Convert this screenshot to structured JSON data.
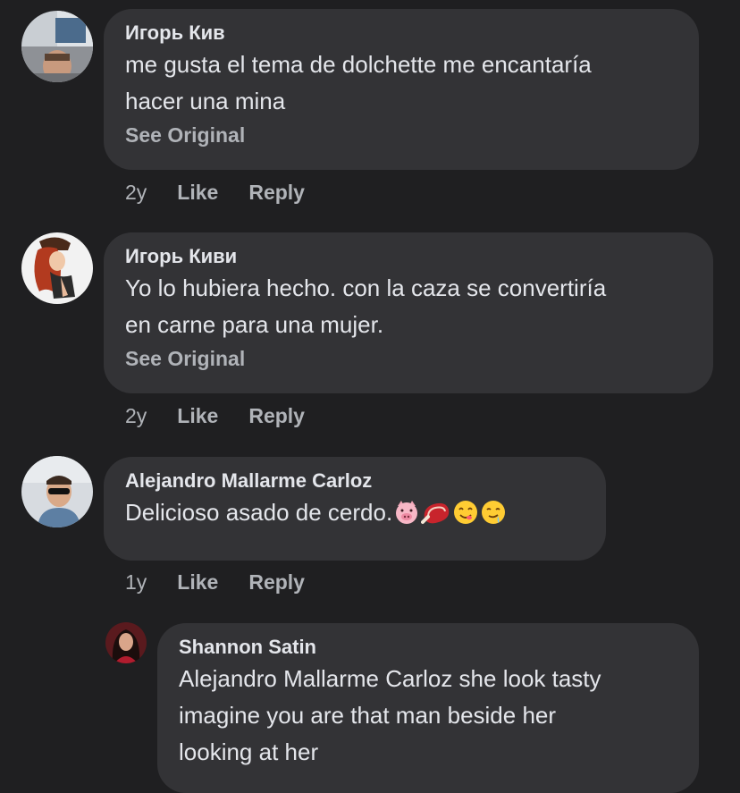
{
  "comments": [
    {
      "author": "Игорь Кив",
      "text": "me gusta el tema de dolchette me encantaría\nhacer una mina",
      "see_original": "See Original",
      "time": "2y",
      "like": "Like",
      "reply": "Reply"
    },
    {
      "author": "Игорь Киви",
      "text": "Yo lo hubiera hecho. con la caza se convertiría\nen carne para una mujer.",
      "see_original": "See Original",
      "time": "2y",
      "like": "Like",
      "reply": "Reply"
    },
    {
      "author": "Alejandro Mallarme Carloz",
      "text": "Delicioso asado de cerdo.",
      "emojis": [
        "pig-face-emoji",
        "meat-emoji",
        "yum-face-emoji",
        "drooling-face-emoji"
      ],
      "time": "1y",
      "like": "Like",
      "reply": "Reply"
    },
    {
      "author": "Shannon Satin",
      "text": "Alejandro Mallarme Carloz she look tasty\nimagine you are that man beside her\nlooking at her"
    }
  ],
  "colors": {
    "background": "#1f1f21",
    "bubble": "#333336",
    "primary_text": "#e4e6eb",
    "secondary_text": "#b0b3b8"
  }
}
